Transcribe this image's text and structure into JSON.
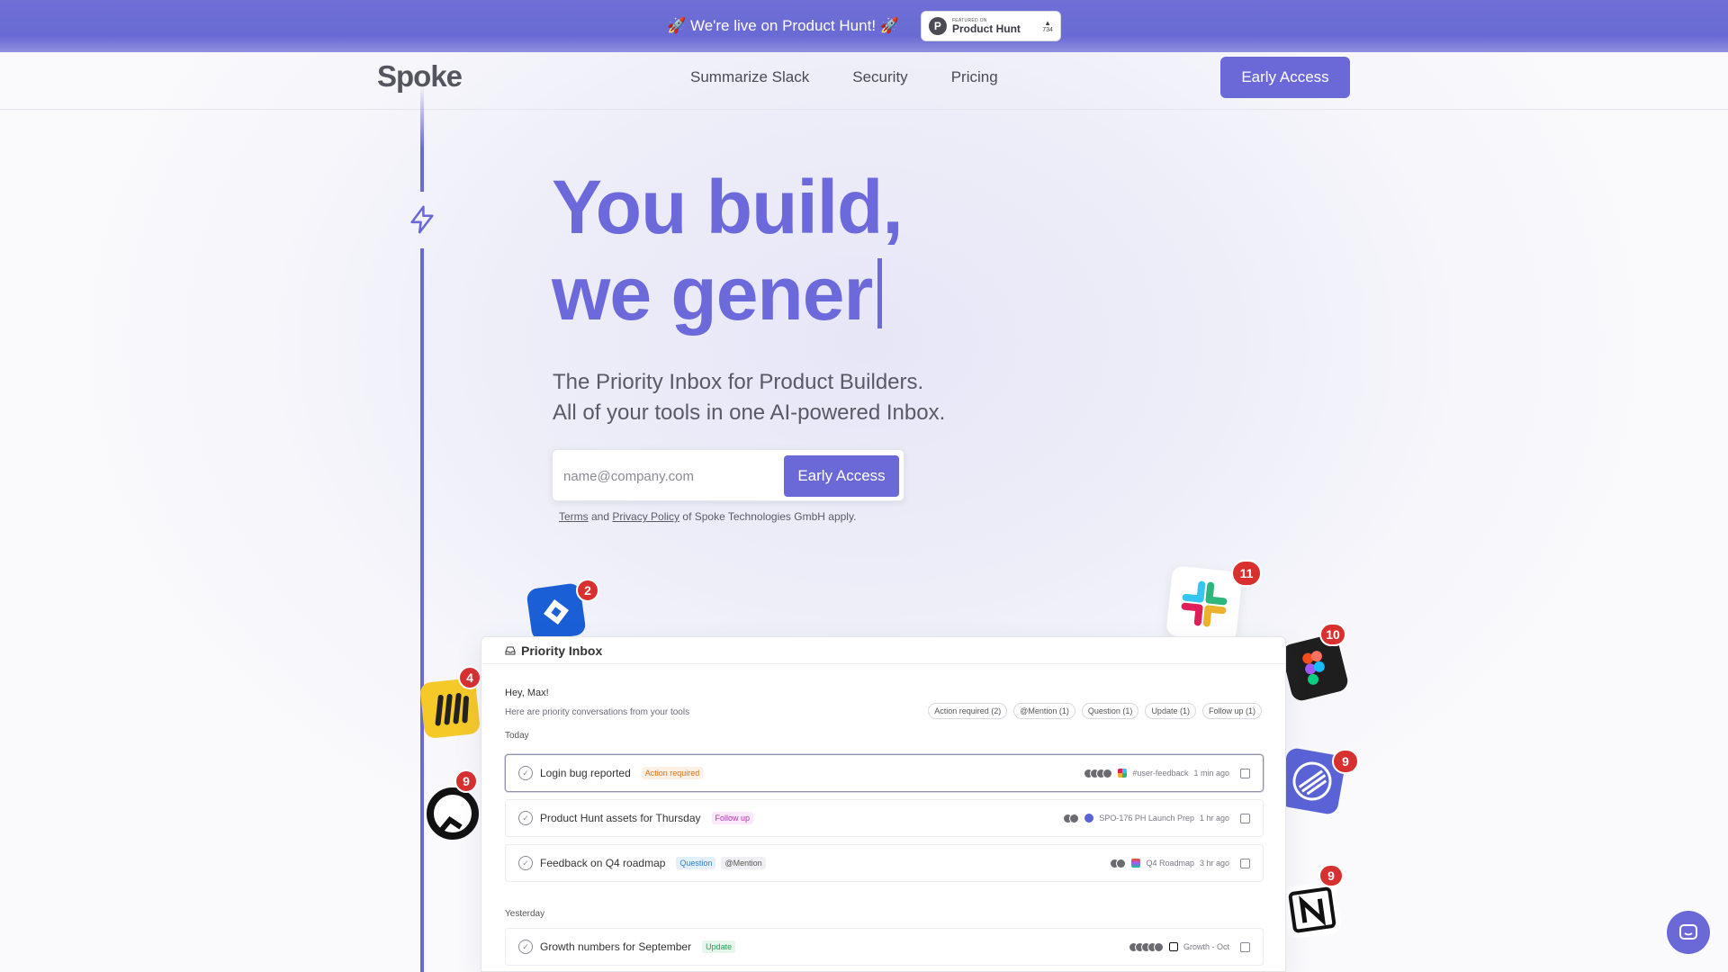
{
  "announcement": {
    "text": "🚀 We're live on Product Hunt! 🚀",
    "ph_featured": "FEATURED ON",
    "ph_name": "Product Hunt",
    "ph_votes": "734"
  },
  "nav": {
    "logo": "Spoke",
    "links": [
      "Summarize Slack",
      "Security",
      "Pricing"
    ],
    "cta": "Early Access"
  },
  "hero": {
    "line1": "You build,",
    "line2": "we gener",
    "subtitle1": "The Priority Inbox for Product Builders.",
    "subtitle2": "All of your tools in one AI-powered Inbox."
  },
  "signup": {
    "placeholder": "name@company.com",
    "button": "Early Access",
    "legal_terms": "Terms",
    "legal_and": " and ",
    "legal_privacy": "Privacy Policy",
    "legal_rest": " of Spoke Technologies GmbH apply."
  },
  "apps": [
    {
      "name": "jira-icon",
      "badge": "2"
    },
    {
      "name": "miro-icon",
      "badge": "4"
    },
    {
      "name": "github-icon",
      "badge": "9"
    },
    {
      "name": "slack-icon",
      "badge": "11"
    },
    {
      "name": "figma-icon",
      "badge": "10"
    },
    {
      "name": "linear-icon",
      "badge": "9"
    },
    {
      "name": "notion-icon",
      "badge": "9"
    }
  ],
  "inbox": {
    "title": "Priority Inbox",
    "greeting": "Hey, Max!",
    "subgreeting": "Here are priority conversations from your tools",
    "filters": [
      "Action required (2)",
      "@Mention (1)",
      "Question (1)",
      "Update (1)",
      "Follow up (1)"
    ],
    "today": "Today",
    "yesterday": "Yesterday",
    "rows": [
      {
        "title": "Login bug reported",
        "tags": [
          "Action required"
        ],
        "source": "#user-feedback",
        "time": "1 min ago"
      },
      {
        "title": "Product Hunt assets for Thursday",
        "tags": [
          "Follow up"
        ],
        "source": "SPO-176 PH Launch Prep",
        "time": "1 hr ago"
      },
      {
        "title": "Feedback on Q4 roadmap",
        "tags": [
          "Question",
          "@Mention"
        ],
        "source": "Q4 Roadmap",
        "time": "3 hr ago"
      },
      {
        "title": "Growth numbers for September",
        "tags": [
          "Update"
        ],
        "source": "Growth - Oct",
        "time": ""
      }
    ]
  },
  "colors": {
    "brand": "#6b68d8",
    "badge": "#d8302f"
  }
}
